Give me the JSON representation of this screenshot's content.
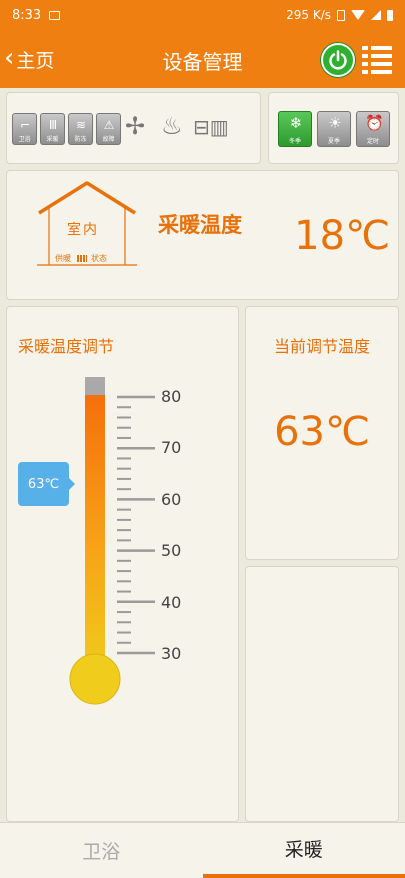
{
  "status_bar": {
    "time": "8:33",
    "speed": "295 K/s"
  },
  "app_bar": {
    "back_label": "主页",
    "title": "设备管理"
  },
  "devices": {
    "items": [
      {
        "label": "卫浴",
        "icon": "shower-icon"
      },
      {
        "label": "采暖",
        "icon": "radiator-icon"
      },
      {
        "label": "防冻",
        "icon": "antifreeze-icon"
      },
      {
        "label": "故障",
        "icon": "warning-icon"
      },
      {
        "label": "",
        "icon": "fan-icon"
      },
      {
        "label": "",
        "icon": "flame-icon"
      },
      {
        "label": "",
        "icon": "pump-icon"
      }
    ]
  },
  "season": {
    "items": [
      {
        "label": "冬季",
        "icon": "snowflake-icon",
        "active": true
      },
      {
        "label": "夏季",
        "icon": "sun-icon",
        "active": false
      },
      {
        "label": "定时",
        "icon": "clock-icon",
        "active": false
      }
    ]
  },
  "indoor": {
    "house_label": "室内",
    "supply_label": "供暖",
    "status_label": "状态",
    "title": "采暖温度",
    "temperature": "18℃"
  },
  "adjust": {
    "title": "采暖温度调节",
    "value_label": "63℃",
    "value": 63,
    "min": 30,
    "max": 80,
    "scale": [
      "80",
      "70",
      "60",
      "50",
      "40",
      "30"
    ]
  },
  "current": {
    "title": "当前调节温度",
    "value": "63℃"
  },
  "tabs": {
    "bath": "卫浴",
    "heat": "采暖"
  },
  "colors": {
    "accent": "#f07f12",
    "power": "#2fb030",
    "tag": "#58b0e8"
  }
}
